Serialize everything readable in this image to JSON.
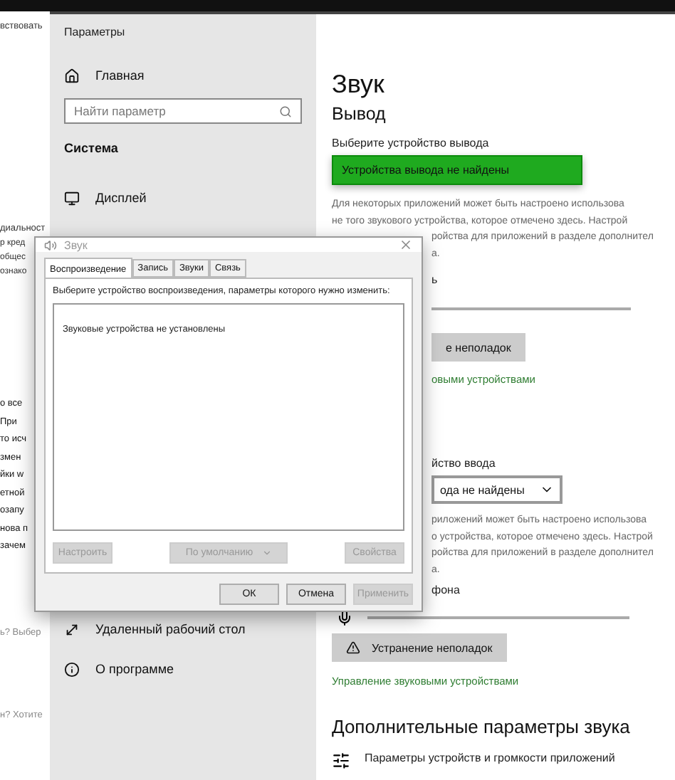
{
  "background_page": {
    "top_text": "вствовать",
    "fragments_upper": [
      "диальност",
      "р кред",
      "общес",
      "ознако"
    ],
    "fragments_middle": [
      "о все",
      "При",
      "то исч",
      "змен",
      "йки w",
      "етной",
      "озапу",
      "нова п",
      "зачем"
    ],
    "fragments_lower": [
      "ь? Выбер",
      "н? Хотите"
    ]
  },
  "settings": {
    "title": "Параметры",
    "home": "Главная",
    "search": {
      "placeholder": "Найти параметр"
    },
    "section": "Система",
    "nav_top": [
      {
        "label": "Дисплей"
      }
    ],
    "nav_bottom": [
      {
        "label": "Удаленный рабочий стол"
      },
      {
        "label": "О программе"
      }
    ],
    "page_title": "Звук",
    "output": {
      "heading": "Вывод",
      "label": "Выберите устройство вывода",
      "device": "Устройства вывода не найдены",
      "description": [
        "Для некоторых приложений может быть настроено использова",
        "не того звукового устройства, которое отмечено здесь. Настрой",
        "ройства для приложений в разделе дополнител",
        "а."
      ],
      "volume_label": "ь",
      "troubleshoot": "е неполадок",
      "manage_link": "овыми устройствами"
    },
    "input": {
      "label": "йство ввода",
      "device": "ода не найдены",
      "description": [
        "риложений может быть настроено использова",
        "о устройства, которое отмечено здесь. Настрой",
        "ройства для приложений в разделе дополнител",
        "а."
      ],
      "volume_label": "фона",
      "troubleshoot": "Устранение неполадок",
      "manage_link": "Управление звуковыми устройствами"
    },
    "advanced": {
      "heading": "Дополнительные параметры звука",
      "item": "Параметры устройств и громкости приложений"
    }
  },
  "dialog": {
    "title": "Звук",
    "tabs": [
      {
        "label": "Воспроизведение",
        "selected": true
      },
      {
        "label": "Запись",
        "selected": false
      },
      {
        "label": "Звуки",
        "selected": false
      },
      {
        "label": "Связь",
        "selected": false
      }
    ],
    "instruction": "Выберите устройство воспроизведения, параметры которого нужно изменить:",
    "empty_message": "Звуковые устройства не установлены",
    "list_buttons": [
      {
        "label": "Настроить",
        "kind": "plain",
        "disabled": true
      },
      {
        "label": "По умолчанию",
        "kind": "split",
        "disabled": true
      },
      {
        "label": "Свойства",
        "kind": "plain",
        "disabled": true
      }
    ],
    "footer_buttons": [
      {
        "label": "ОК",
        "disabled": false
      },
      {
        "label": "Отмена",
        "disabled": false
      },
      {
        "label": "Применить",
        "disabled": true
      }
    ]
  }
}
